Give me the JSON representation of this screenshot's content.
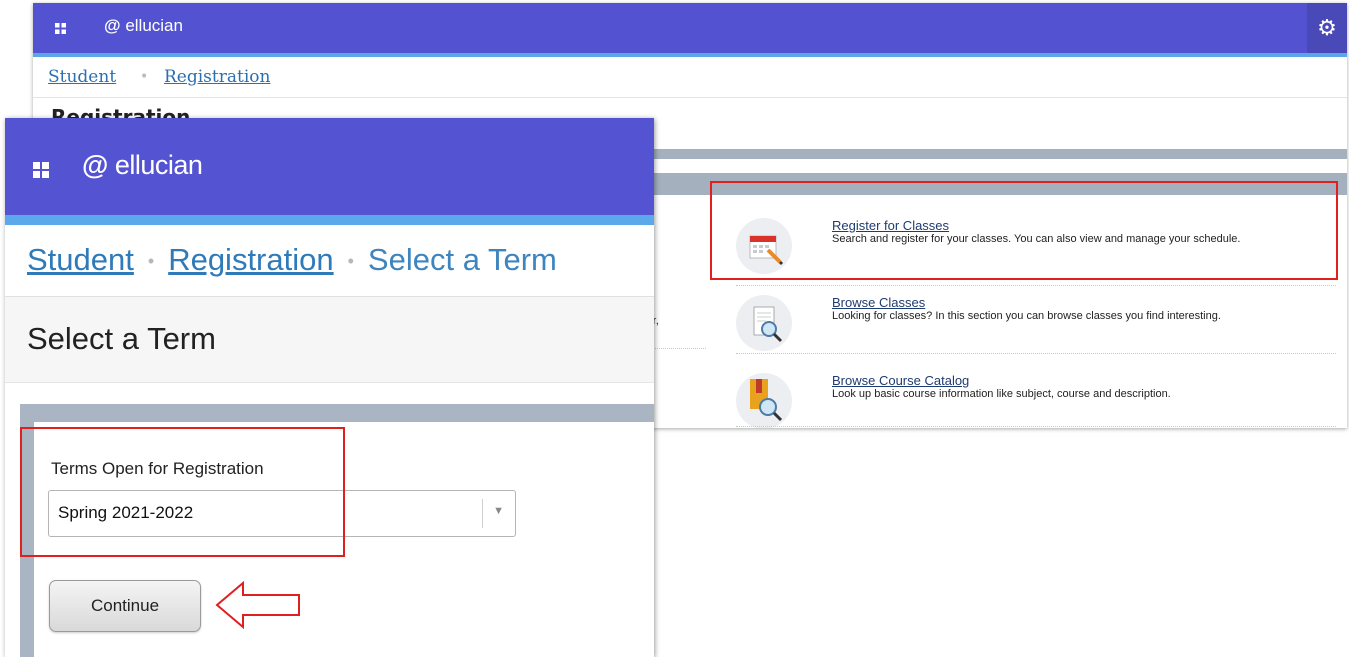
{
  "background_window": {
    "brand": "ellucian",
    "breadcrumb": [
      "Student",
      "Registration"
    ],
    "heading": "Registration",
    "partial_text": "ster,",
    "items": [
      {
        "title": "Register for Classes",
        "desc": "Search and register for your classes. You can also view and manage your schedule.",
        "icon": "calendar-pencil-icon"
      },
      {
        "title": "Browse Classes",
        "desc": "Looking for classes? In this section you can browse classes you find interesting.",
        "icon": "document-magnifier-icon"
      },
      {
        "title": "Browse Course Catalog",
        "desc": "Look up basic course information like subject, course and description.",
        "icon": "book-magnifier-icon"
      }
    ]
  },
  "foreground_window": {
    "brand": "ellucian",
    "breadcrumb": {
      "student": "Student",
      "registration": "Registration",
      "current": "Select a Term"
    },
    "page_title": "Select a Term",
    "terms_label": "Terms Open for Registration",
    "selected_term": "Spring 2021-2022",
    "continue_label": "Continue"
  },
  "colors": {
    "topbar": "#5454d3",
    "accent_border": "#5ba8ea",
    "link": "#2f7ab8",
    "annotation": "#e01f1f"
  }
}
